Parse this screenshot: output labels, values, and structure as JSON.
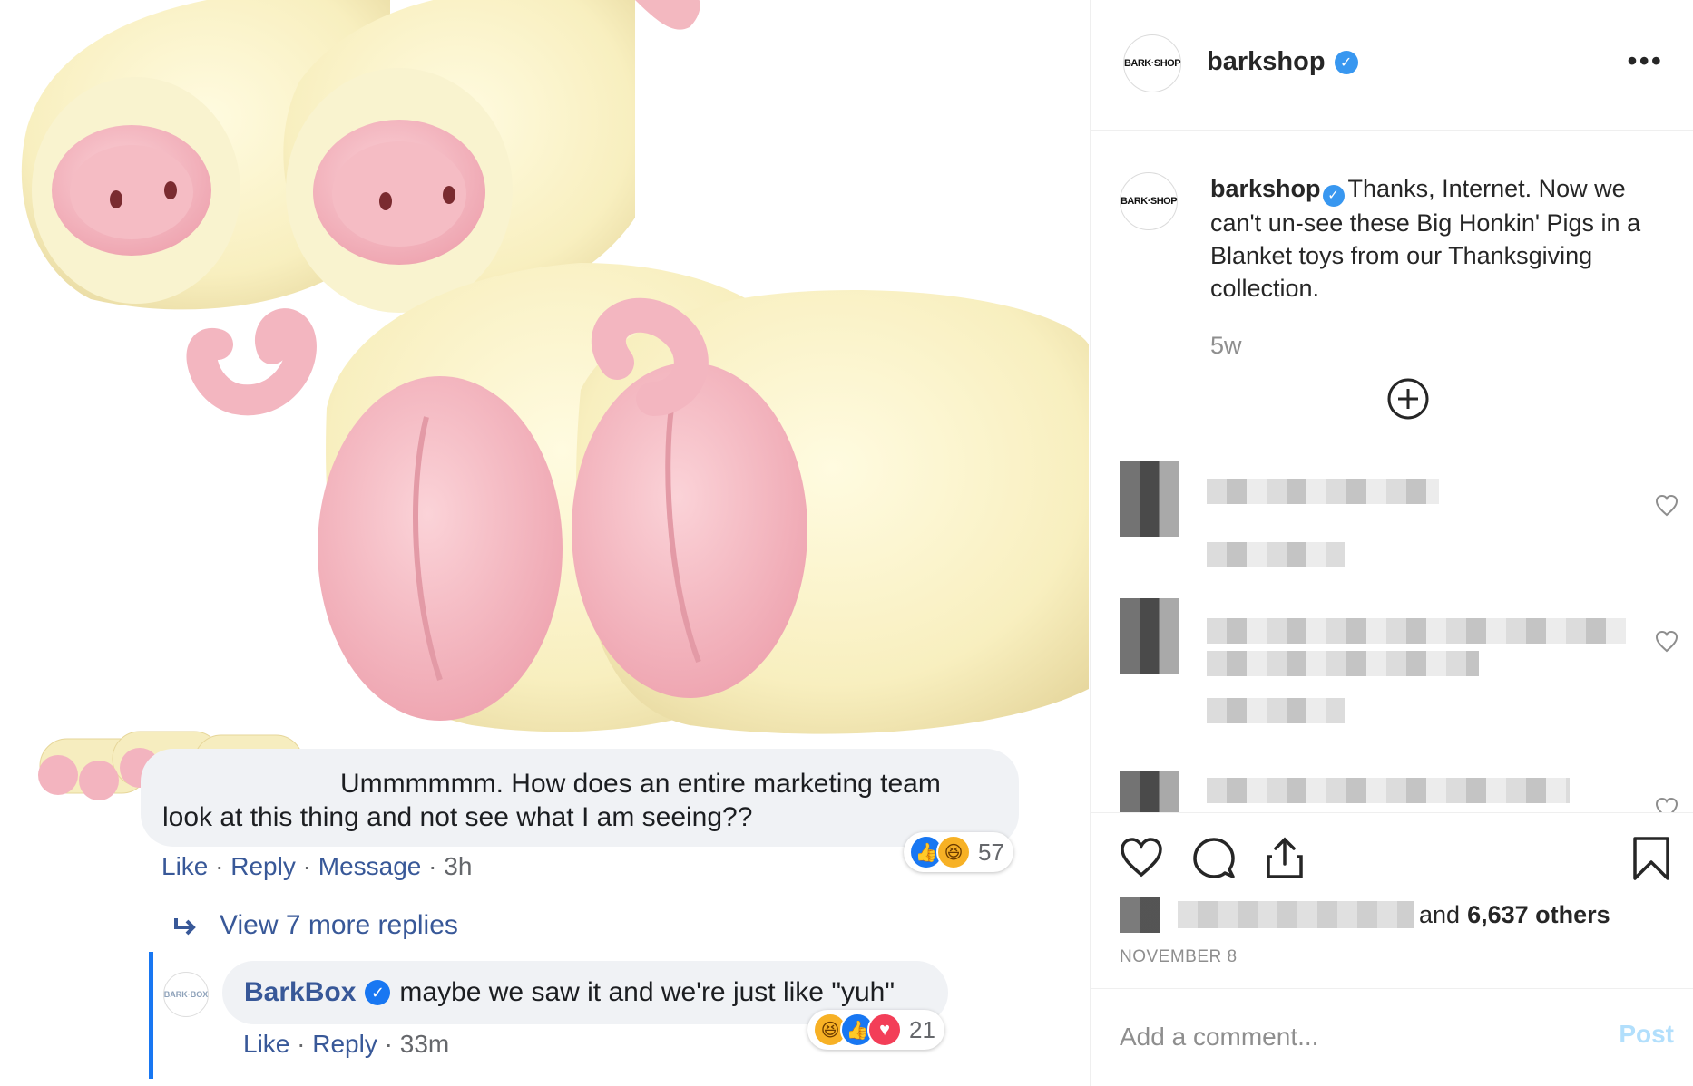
{
  "post": {
    "username": "barkshop",
    "avatar_text": "BARK·SHOP",
    "caption": "Thanks, Internet. Now we can't un-see these Big Honkin' Pigs in a Blanket toys from our Thanksgiving collection.",
    "time_ago": "5w",
    "likes_suffix": "and",
    "likes_count": "6,637 others",
    "date": "NOVEMBER 8",
    "comment_placeholder": "Add a comment...",
    "post_label": "Post"
  },
  "icons": {
    "verified": "verified-badge-icon",
    "more": "more-options-icon",
    "load_more": "plus-circle-icon",
    "like": "heart-icon",
    "comment": "comment-bubble-icon",
    "share": "share-icon",
    "save": "bookmark-icon"
  },
  "facebook": {
    "main_comment": {
      "text": "Ummmmmm. How does an entire marketing team look at this thing and not see what I am seeing??",
      "actions": [
        "Like",
        "Reply",
        "Message"
      ],
      "time": "3h",
      "reaction_count": "57"
    },
    "view_more": "View 7 more replies",
    "reply": {
      "author": "BarkBox",
      "avatar_text": "BARK·BOX",
      "text": "maybe we saw it and we're just like \"yuh\"",
      "actions": [
        "Like",
        "Reply"
      ],
      "time": "33m",
      "reaction_count": "21"
    }
  },
  "colors": {
    "ig_blue": "#3897f0",
    "fb_blue": "#1877f2",
    "fb_link": "#385898",
    "post_disabled": "#b2dffc",
    "muted": "#8e8e8e"
  }
}
